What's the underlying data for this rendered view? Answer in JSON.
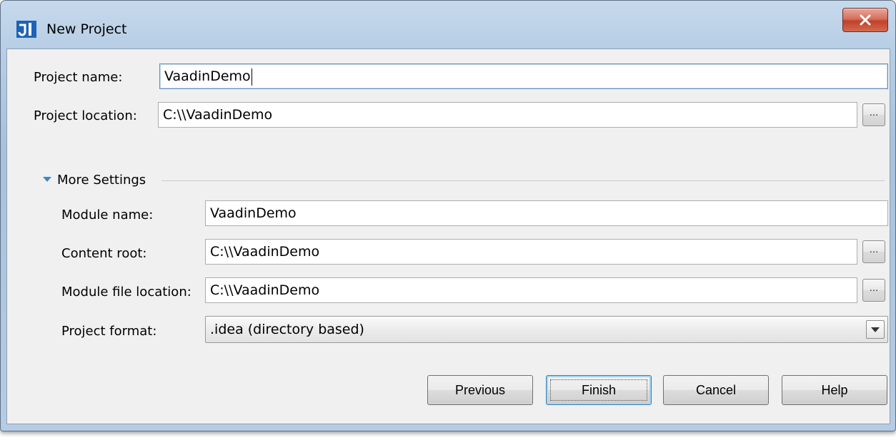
{
  "window": {
    "title": "New Project",
    "close_label": "X"
  },
  "form": {
    "project_name_label": "Project name:",
    "project_name_value": "VaadinDemo",
    "project_location_label": "Project location:",
    "project_location_value": "C:\\\\VaadinDemo",
    "browse_label": "..."
  },
  "more_settings": {
    "header": "More Settings",
    "module_name_label": "Module name:",
    "module_name_value": "VaadinDemo",
    "content_root_label": "Content root:",
    "content_root_value": "C:\\\\VaadinDemo",
    "module_file_location_label": "Module file location:",
    "module_file_location_value": "C:\\\\VaadinDemo",
    "project_format_label": "Project format:",
    "project_format_value": ".idea (directory based)"
  },
  "buttons": {
    "previous": "Previous",
    "finish": "Finish",
    "cancel": "Cancel",
    "help": "Help"
  },
  "colors": {
    "accent": "#3c86c8",
    "close_button": "#c2412b"
  }
}
